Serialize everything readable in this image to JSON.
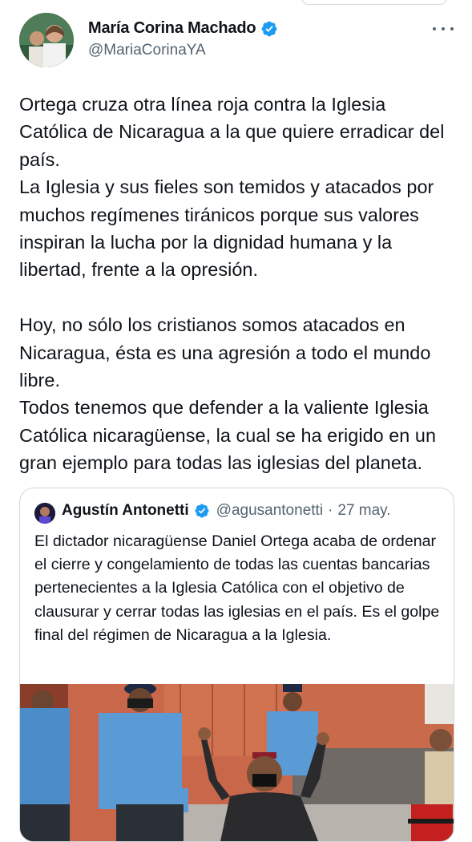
{
  "tweet": {
    "author_name": "María Corina Machado",
    "author_handle": "@MariaCorinaYA",
    "body": "Ortega cruza otra línea roja contra la Iglesia Católica de Nicaragua a la que quiere erradicar del país.\nLa Iglesia y sus fieles son temidos y atacados por muchos regímenes tiránicos porque sus valores inspiran la lucha por la dignidad humana y la libertad, frente a la opresión.\n\nHoy, no sólo los cristianos somos atacados en Nicaragua, ésta es una agresión a todo el mundo libre.\nTodos tenemos que defender a la valiente Iglesia Católica nicaragüense, la cual se ha erigido en un gran ejemplo para todas las iglesias del planeta."
  },
  "quoted": {
    "author_name": "Agustín Antonetti",
    "author_handle": "@agusantonetti",
    "separator": "·",
    "date": "27 may.",
    "body": "El dictador nicaragüense Daniel Ortega acaba de ordenar el cierre y congelamiento de todas las cuentas bancarias pertenecientes a la Iglesia Católica con el objetivo de clausurar y cerrar todas las iglesias en el país. Es el golpe final del régimen de Nicaragua a la Iglesia."
  },
  "icons": {
    "verified": "verified-badge-icon",
    "more": "more-options-icon"
  },
  "colors": {
    "verified_blue": "#1d9bf0",
    "secondary_text": "#536471",
    "border": "#cfd9de"
  }
}
